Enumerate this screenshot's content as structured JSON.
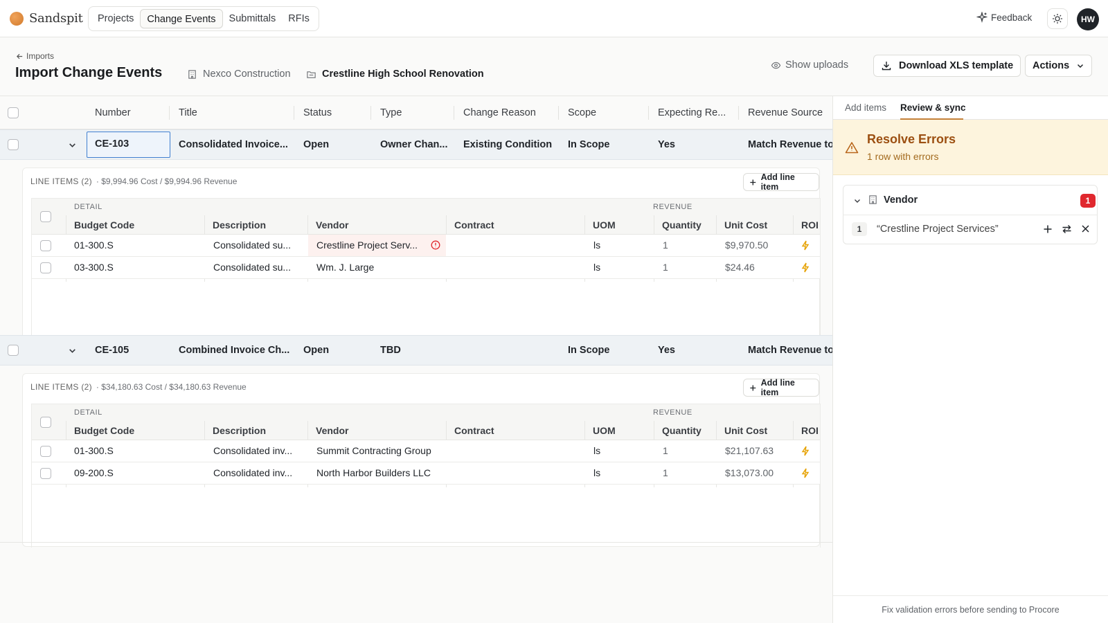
{
  "app": {
    "name": "Sandspit"
  },
  "nav": {
    "tabs": [
      {
        "label": "Projects",
        "active": false
      },
      {
        "label": "Change Events",
        "active": true
      },
      {
        "label": "Submittals",
        "active": false
      },
      {
        "label": "RFIs",
        "active": false
      }
    ]
  },
  "topbar": {
    "feedback_label": "Feedback",
    "user_initials": "HW"
  },
  "header": {
    "breadcrumb": "Imports",
    "title": "Import Change Events",
    "company": "Nexco Construction",
    "project": "Crestline High School Renovation",
    "show_uploads_label": "Show uploads",
    "download_label": "Download XLS template",
    "actions_label": "Actions"
  },
  "grid": {
    "columns": [
      "Number",
      "Title",
      "Status",
      "Type",
      "Change Reason",
      "Scope",
      "Expecting Re...",
      "Revenue Source"
    ],
    "events": [
      {
        "number": "CE-103",
        "title": "Consolidated Invoice...",
        "status": "Open",
        "type": "Owner Chan...",
        "change_reason": "Existing Condition",
        "scope": "In Scope",
        "expecting_revenue": "Yes",
        "revenue_source": "Match Revenue to",
        "line_items": {
          "title": "LINE ITEMS (2)",
          "summary": "· $9,994.96 Cost / $9,994.96 Revenue",
          "add_label": "Add line item",
          "group_detail": "DETAIL",
          "group_revenue": "REVENUE",
          "columns": [
            "Budget Code",
            "Description",
            "Vendor",
            "Contract",
            "UOM",
            "Quantity",
            "Unit Cost",
            "ROI"
          ],
          "rows": [
            {
              "budget_code": "01-300.S",
              "description": "Consolidated su...",
              "vendor": "Crestline Project Serv...",
              "vendor_error": true,
              "contract": "",
              "uom": "ls",
              "quantity": "1",
              "unit_cost": "$9,970.50"
            },
            {
              "budget_code": "03-300.S",
              "description": "Consolidated su...",
              "vendor": "Wm. J. Large",
              "vendor_error": false,
              "contract": "",
              "uom": "ls",
              "quantity": "1",
              "unit_cost": "$24.46"
            }
          ]
        }
      },
      {
        "number": "CE-105",
        "title": "Combined Invoice Ch...",
        "status": "Open",
        "type": "TBD",
        "change_reason": "",
        "scope": "In Scope",
        "expecting_revenue": "Yes",
        "revenue_source": "Match Revenue to",
        "line_items": {
          "title": "LINE ITEMS (2)",
          "summary": "· $34,180.63 Cost / $34,180.63 Revenue",
          "add_label": "Add line item",
          "group_detail": "DETAIL",
          "group_revenue": "REVENUE",
          "columns": [
            "Budget Code",
            "Description",
            "Vendor",
            "Contract",
            "UOM",
            "Quantity",
            "Unit Cost",
            "ROI"
          ],
          "rows": [
            {
              "budget_code": "01-300.S",
              "description": "Consolidated inv...",
              "vendor": "Summit Contracting Group",
              "vendor_error": false,
              "contract": "",
              "uom": "ls",
              "quantity": "1",
              "unit_cost": "$21,107.63"
            },
            {
              "budget_code": "09-200.S",
              "description": "Consolidated inv...",
              "vendor": "North Harbor Builders LLC",
              "vendor_error": false,
              "contract": "",
              "uom": "ls",
              "quantity": "1",
              "unit_cost": "$13,073.00"
            }
          ]
        }
      }
    ]
  },
  "side": {
    "tabs": [
      {
        "label": "Add items"
      },
      {
        "label": "Review & sync"
      }
    ],
    "resolve_title": "Resolve Errors",
    "resolve_sub": "1 row with errors",
    "vendor_group": {
      "title": "Vendor",
      "count": "1",
      "item_index": "1",
      "item_value": "“Crestline Project Services”"
    },
    "footer": "Fix validation errors before sending to Procore"
  },
  "colors": {
    "accent": "#c4813a",
    "error": "#e0282e",
    "warning_bg": "#fdf4dd",
    "focus": "#3f7fd0",
    "bolt": "#e6a100"
  }
}
